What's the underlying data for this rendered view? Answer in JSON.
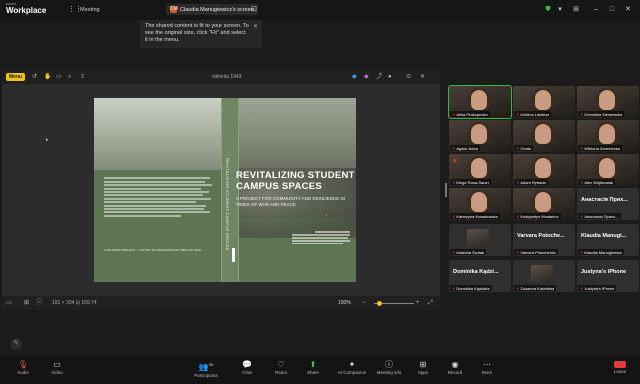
{
  "app": {
    "brand_small": "zoom",
    "brand_name": "Workplace"
  },
  "topbar": {
    "meeting_label": "Meeting",
    "share_badge": "CM",
    "share_label": "Claudia Manugiewicz's screen"
  },
  "tooltip": {
    "text": "The shared content is fit to your screen. To see the original size, click \"Fit\" and select it in the menu."
  },
  "viewer": {
    "menu_label": "Menu",
    "title": "viktoriia 1943",
    "page_info": "191 × 304   ⊟ 169.74 ",
    "zoom": "100%"
  },
  "cover": {
    "spine": "REVITALIZING STUDENT CAMPUS SPACES",
    "title_line1": "REVITALIZING STUDENT",
    "title_line2": "CAMPUS SPACES",
    "subtitle": "A PROJECT FOR COMMUNITY AND RESILIENCE IN TIMES OF WAR AND PEACE",
    "footer": "A STUDENT PROJECT · A STUDY OF RESILIENCE IN TIMES OF WAR"
  },
  "participants": [
    {
      "name": "Alina Prokopenko",
      "type": "video",
      "active": true
    },
    {
      "name": "Kristina Lawless",
      "type": "video",
      "active": false
    },
    {
      "name": "Dominika Sieniewska",
      "type": "video",
      "active": false
    },
    {
      "name": "Agata Jelica",
      "type": "video",
      "active": false
    },
    {
      "name": "Chatu",
      "type": "video",
      "active": false
    },
    {
      "name": "Wiktoria Zarembska",
      "type": "video",
      "active": false
    },
    {
      "name": "Kinga Rosa-Sauer",
      "type": "video",
      "active": false
    },
    {
      "name": "Adam Rybacki",
      "type": "video",
      "active": false
    },
    {
      "name": "Alex Wojtkowiak",
      "type": "video",
      "active": false
    },
    {
      "name": "Katarzyna Kowalewska",
      "type": "video",
      "active": false
    },
    {
      "name": "Kostyantyn Mostahov",
      "type": "video",
      "active": false
    },
    {
      "name": "Анастасія Прихо...",
      "big": "Анастасія Прих...",
      "type": "name",
      "active": false
    },
    {
      "name": "Malwina Świtak",
      "type": "thumb",
      "active": false
    },
    {
      "name": "Varvara Potochenko",
      "big": "Varvara Potoche...",
      "type": "name",
      "active": false
    },
    {
      "name": "Klaudia Manugiewicz",
      "big": "Klaudia Manugi...",
      "type": "name",
      "active": false
    },
    {
      "name": "Dominika Kądziela",
      "big": "Dominika Kądzi...",
      "type": "name",
      "active": false
    },
    {
      "name": "Zuzanna Kościelna",
      "type": "thumb",
      "active": false
    },
    {
      "name": "Justyna's iPhone",
      "big": "Justyna's iPhone",
      "type": "name",
      "active": false
    }
  ],
  "toolbar": {
    "audio": "Audio",
    "video": "Video",
    "participants": "Participants",
    "participants_count": "20",
    "chat": "Chat",
    "react": "React",
    "share": "Share",
    "ai": "AI Companion",
    "meeting_info": "Meeting info",
    "apps": "Apps",
    "record": "Record",
    "more": "More",
    "leave": "Leave"
  }
}
